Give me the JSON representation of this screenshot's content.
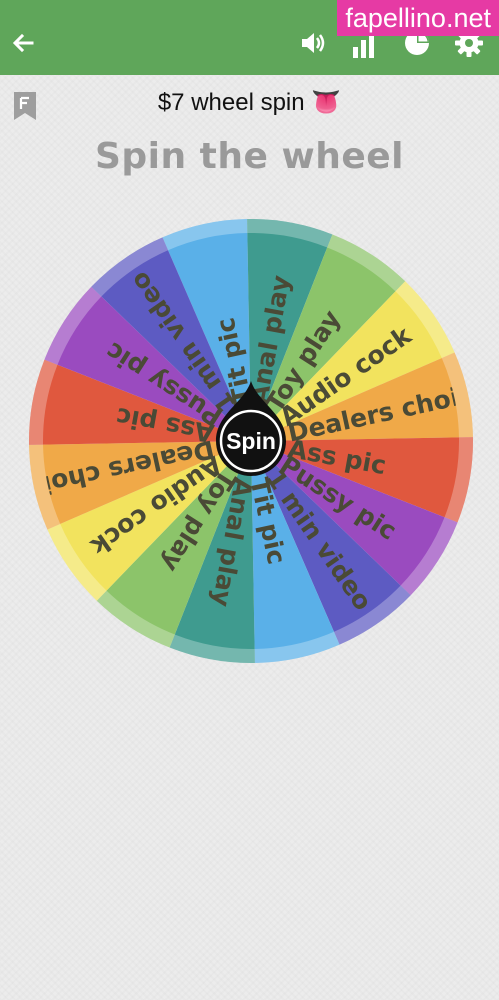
{
  "header": {
    "back_icon": "arrow-left-icon",
    "sound_icon": "speaker-icon",
    "stats_icon": "bar-chart-icon",
    "pie_icon": "pie-chart-icon",
    "settings_icon": "gear-icon",
    "bar_color": "#5fa65a"
  },
  "watermark": "fapellino.net",
  "subtitle": "$7 wheel spin 👅",
  "heading": "Spin the wheel",
  "spin_button": "Spin",
  "wheel": {
    "segments": [
      {
        "label": "Tit pic",
        "color": "#5ab0e8"
      },
      {
        "label": "Anal play",
        "color": "#3f9b8f"
      },
      {
        "label": "Toy play",
        "color": "#8cc46a"
      },
      {
        "label": "Audio cock",
        "color": "#f2e35e"
      },
      {
        "label": "Dealers choice",
        "color": "#f0a948"
      },
      {
        "label": "Ass pic",
        "color": "#e0583e"
      },
      {
        "label": "Pussy pic",
        "color": "#9a4bbf"
      },
      {
        "label": "1 min video",
        "color": "#5d5bc2"
      },
      {
        "label": "Tit pic",
        "color": "#5ab0e8"
      },
      {
        "label": "Anal play",
        "color": "#3f9b8f"
      },
      {
        "label": "Toy play",
        "color": "#8cc46a"
      },
      {
        "label": "Audio cock",
        "color": "#f2e35e"
      },
      {
        "label": "Dealers choice",
        "color": "#f0a948"
      },
      {
        "label": "Ass pic",
        "color": "#e0583e"
      },
      {
        "label": "Pussy pic",
        "color": "#9a4bbf"
      },
      {
        "label": "1 min video",
        "color": "#5d5bc2"
      }
    ],
    "label_color": "#4a4a36"
  }
}
